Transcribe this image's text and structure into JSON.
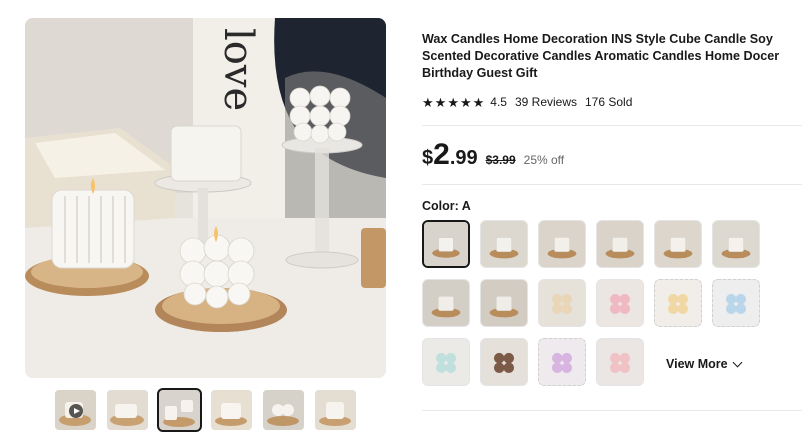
{
  "product": {
    "title": "Wax Candles Home Decoration INS Style Cube Candle Soy Scented Decorative Candles Aromatic Candles Home Docer Birthday Guest Gift",
    "rating": "4.5",
    "reviews": "39 Reviews",
    "sold": "176 Sold",
    "stars_filled": 4.5
  },
  "main_image": {
    "poster_text": "love"
  },
  "price": {
    "currency": "$",
    "integer": "2",
    "decimal": ".99",
    "original": "$3.99",
    "discount": "25% off"
  },
  "color": {
    "label": "Color: A",
    "swatches": [
      {
        "icon": "candle-on-wood",
        "bg": "#d8d3cb",
        "candle": "#f4f2ee",
        "selected": true
      },
      {
        "icon": "candle-on-wood",
        "bg": "#dcd7cf",
        "candle": "#f3f1ec"
      },
      {
        "icon": "candle-on-wood",
        "bg": "#dad4ca",
        "candle": "#f3f0ea"
      },
      {
        "icon": "candle-on-wood",
        "bg": "#d9d3c9",
        "candle": "#f2efe9"
      },
      {
        "icon": "candle-on-wood",
        "bg": "#dcd6cd",
        "candle": "#f4f1ec"
      },
      {
        "icon": "candle-on-wood",
        "bg": "#ddd8d0",
        "candle": "#f5f2ee"
      },
      {
        "icon": "candle-on-wood",
        "bg": "#d3cec6",
        "candle": "#f1eee9"
      },
      {
        "icon": "candle-on-wood",
        "bg": "#d2ccc3",
        "candle": "#f0ede8"
      },
      {
        "icon": "bubble-candle",
        "bg": "#e6e1d9",
        "candle": "#e9d6b8"
      },
      {
        "icon": "bubble-candle",
        "bg": "#ece6e2",
        "candle": "#f0b9c2"
      },
      {
        "icon": "bubble-candle",
        "bg": "#f1eeea",
        "candle": "#f1d7a4",
        "dashed": true
      },
      {
        "icon": "bubble-candle",
        "bg": "#eeeeee",
        "candle": "#b9d6ea",
        "dashed": true
      },
      {
        "icon": "bubble-candle",
        "bg": "#eceae7",
        "candle": "#bfe0dd"
      },
      {
        "icon": "bubble-candle",
        "bg": "#e6e0da",
        "candle": "#7b5a47"
      },
      {
        "icon": "bubble-candle",
        "bg": "#efeaee",
        "candle": "#d7b5e0",
        "dashed": true
      },
      {
        "icon": "bubble-candle",
        "bg": "#ebe6e3",
        "candle": "#f0c2c6"
      }
    ],
    "view_more": "View More"
  },
  "thumbnails": [
    {
      "icon": "video-thumbnail",
      "bg": "#dad3c8"
    },
    {
      "icon": "candle-thumbnail",
      "bg": "#e2dcd2"
    },
    {
      "icon": "candle-thumbnail",
      "bg": "#d8d3cc",
      "selected": true
    },
    {
      "icon": "candle-thumbnail",
      "bg": "#e6dfd2"
    },
    {
      "icon": "candle-thumbnail",
      "bg": "#d6d1c9"
    },
    {
      "icon": "candle-thumbnail",
      "bg": "#e4ddd2"
    }
  ],
  "colors": {
    "text": "#191919",
    "muted": "#666666",
    "divider": "#e8e8e8",
    "wood": "#b98c5c"
  }
}
